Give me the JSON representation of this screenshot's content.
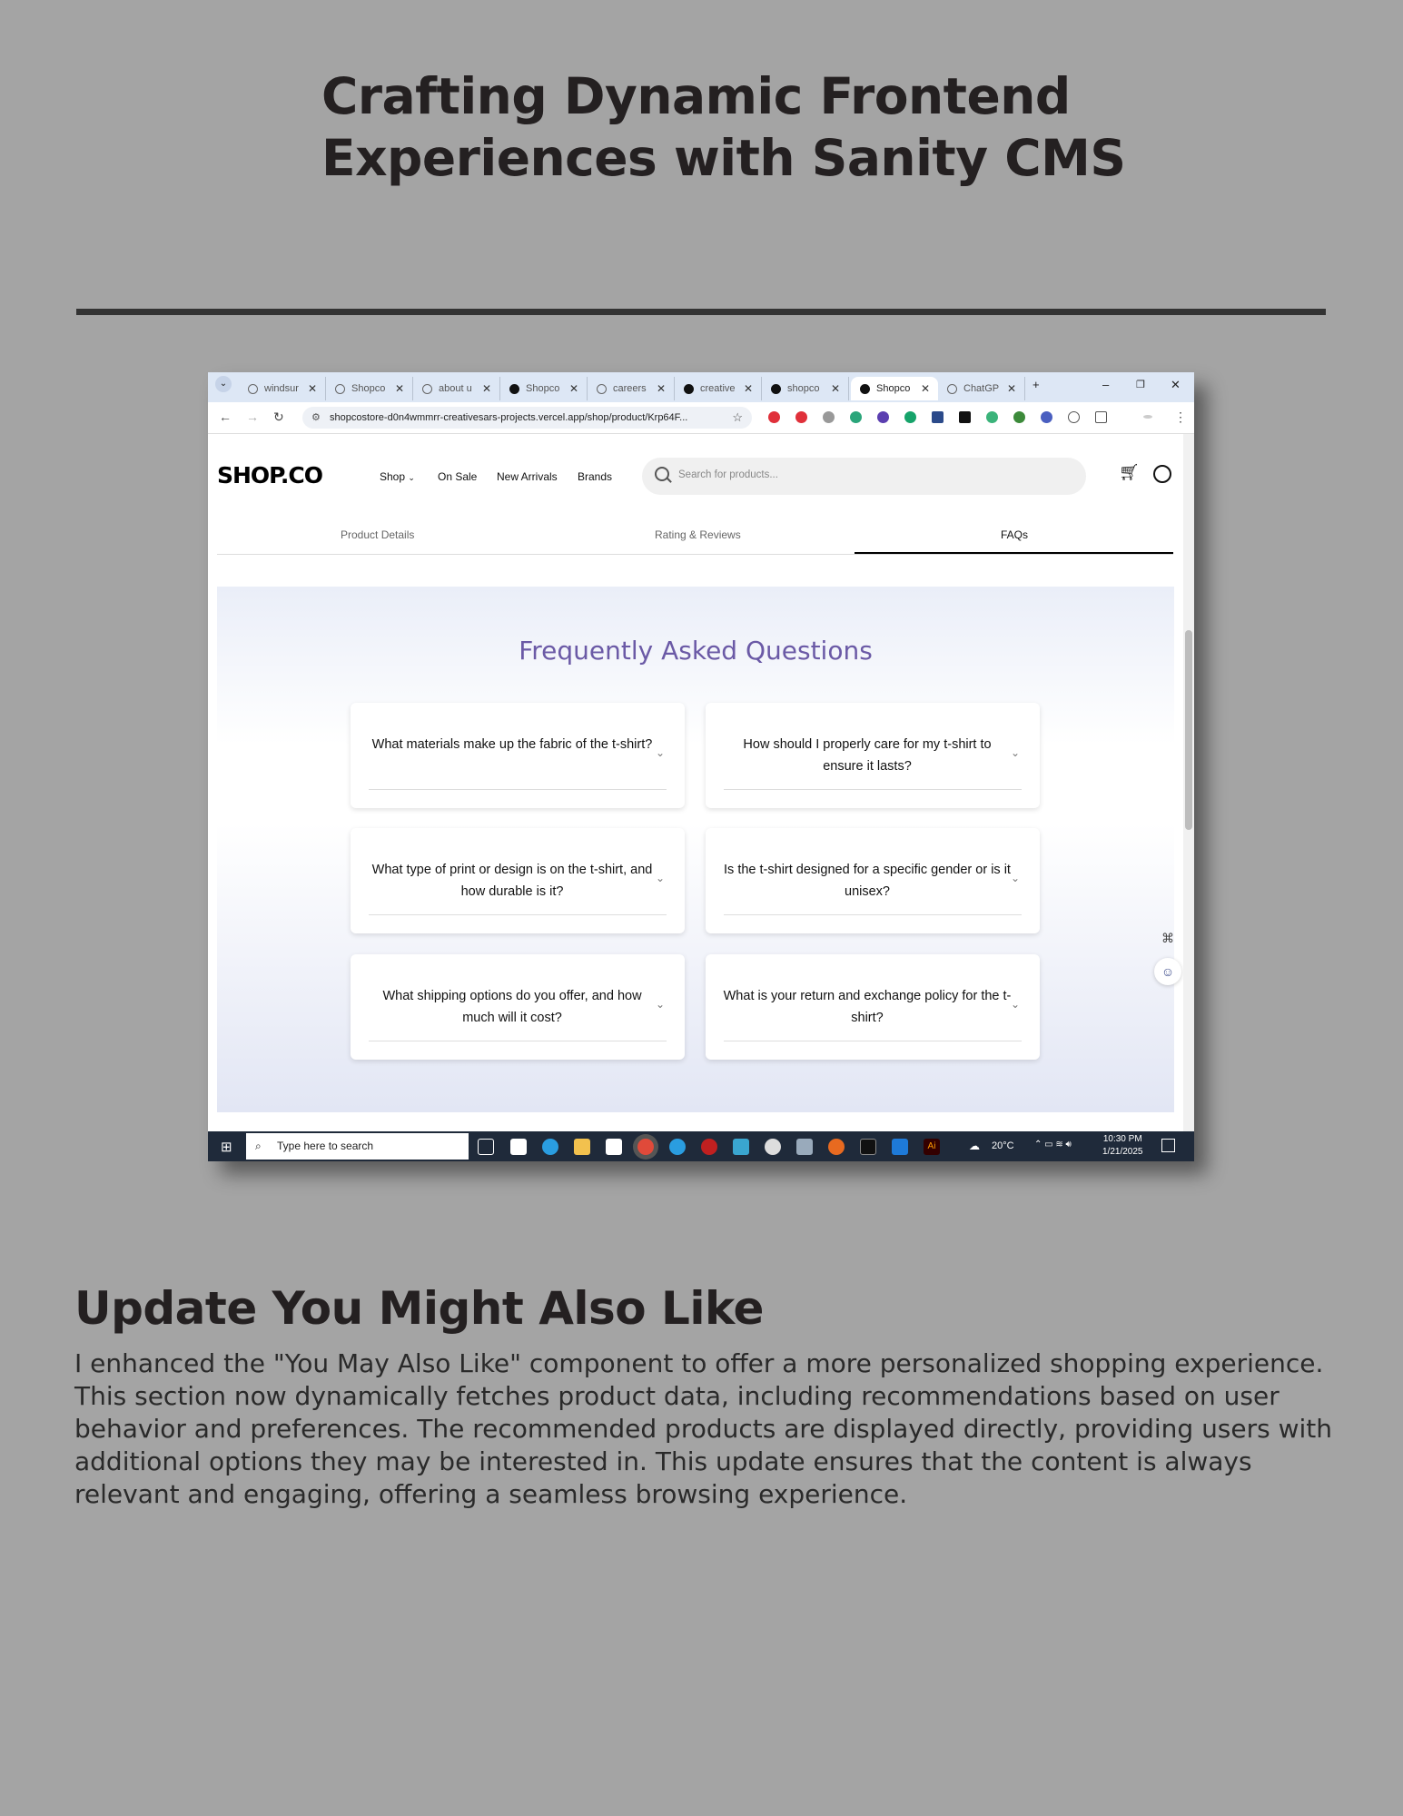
{
  "heading": "Crafting Dynamic Frontend Experiences with Sanity CMS",
  "browser": {
    "tabs": [
      {
        "label": "windsur",
        "icon": "google-icon"
      },
      {
        "label": "Shopco",
        "icon": "globe-icon"
      },
      {
        "label": "about u",
        "icon": "google-icon"
      },
      {
        "label": "Shopco",
        "icon": "vercel-icon"
      },
      {
        "label": "careers",
        "icon": "google-icon"
      },
      {
        "label": "creative",
        "icon": "github-icon"
      },
      {
        "label": "shopco",
        "icon": "vercel-icon"
      },
      {
        "label": "Shopco",
        "icon": "vercel-icon",
        "active": true
      },
      {
        "label": "ChatGP",
        "icon": "chatgpt-icon"
      }
    ],
    "new_tab": "+",
    "url": "shopcostore-d0n4wmmrr-creativesars-projects.vercel.app/shop/product/Krp64F..."
  },
  "site": {
    "logo": "SHOP.CO",
    "nav": [
      "Shop",
      "On Sale",
      "New Arrivals",
      "Brands"
    ],
    "search_placeholder": "Search for products...",
    "product_tabs": [
      "Product Details",
      "Rating & Reviews",
      "FAQs"
    ],
    "active_tab": "FAQs",
    "faq_title": "Frequently Asked Questions",
    "faqs": [
      "What materials make up the fabric of the t-shirt?",
      "How should I properly care for my t-shirt to ensure it lasts?",
      "What type of print or design is on the t-shirt, and how durable is it?",
      "Is the t-shirt designed for a specific gender or is it unisex?",
      "What shipping options do you offer, and how much will it cost?",
      "What is your return and exchange policy for the t-shirt?"
    ]
  },
  "taskbar": {
    "search_placeholder": "Type here to search",
    "weather": "20°C",
    "time": "10:30 PM",
    "date": "1/21/2025"
  },
  "section": {
    "title": "Update You Might Also Like",
    "body": "I enhanced the \"You May Also Like\" component to offer a more personalized shopping experience. This section now dynamically fetches product data, including recommendations based on user behavior and preferences. The recommended products are displayed directly, providing users with additional options they may be interested in. This update ensures that the content is always relevant and engaging, offering a seamless browsing experience."
  },
  "colors": {
    "background": "#a4a4a4",
    "faq_title": "#6b5aa6",
    "taskbar": "#1f2a3a",
    "tabbar": "#dde7f5"
  }
}
